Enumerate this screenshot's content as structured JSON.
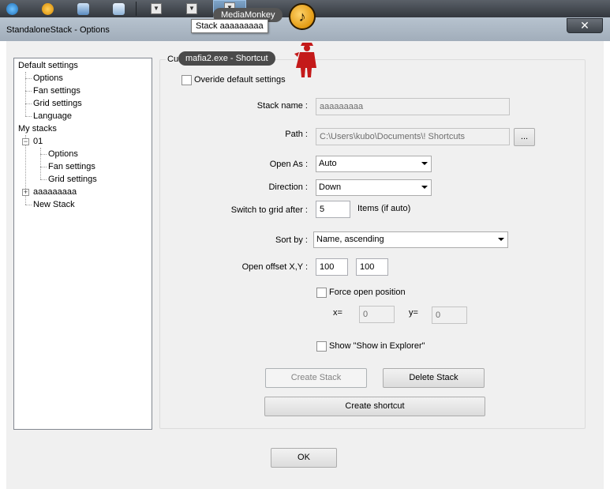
{
  "taskbar": {
    "media_monkey_label": "MediaMonkey",
    "stack_tooltip": "Stack aaaaaaaaa",
    "shortcut_tooltip": "mafia2.exe - Shortcut",
    "stack_icon_glyph": "▼",
    "colors": {
      "active_button": "#6b8fb4"
    }
  },
  "window": {
    "title": "StandaloneStack - Options",
    "close_glyph": "✕"
  },
  "tree": {
    "default_settings": "Default settings",
    "default_children": [
      "Options",
      "Fan settings",
      "Grid settings",
      "Language"
    ],
    "my_stacks": "My stacks",
    "stack_01": "01",
    "stack_01_expander": "−",
    "stack_01_children": [
      "Options",
      "Fan settings",
      "Grid settings"
    ],
    "stack_a": "aaaaaaaaa",
    "stack_a_expander": "+",
    "new_stack": "New Stack"
  },
  "form": {
    "group_caption": "Cus",
    "override_label": "Overide default  settings",
    "stack_name_label": "Stack name :",
    "stack_name_value": "aaaaaaaaa",
    "path_label": "Path :",
    "path_value": "C:\\Users\\kubo\\Documents\\! Shortcuts",
    "browse_label": "...",
    "open_as_label": "Open As :",
    "open_as_value": "Auto",
    "direction_label": "Direction :",
    "direction_value": "Down",
    "switch_grid_label": "Switch to grid after :",
    "switch_grid_value": "5",
    "items_label": "Items (if auto)",
    "sort_by_label": "Sort by :",
    "sort_by_value": "Name, ascending",
    "offset_label": "Open offset X,Y :",
    "offset_x": "100",
    "offset_y": "100",
    "force_open_label": "Force open position",
    "x_label": "x=",
    "x_value": "0",
    "y_label": "y=",
    "y_value": "0",
    "show_explorer_label": "Show \"Show in Explorer\"",
    "create_stack": "Create Stack",
    "delete_stack": "Delete Stack",
    "create_shortcut": "Create shortcut",
    "ok": "OK"
  }
}
